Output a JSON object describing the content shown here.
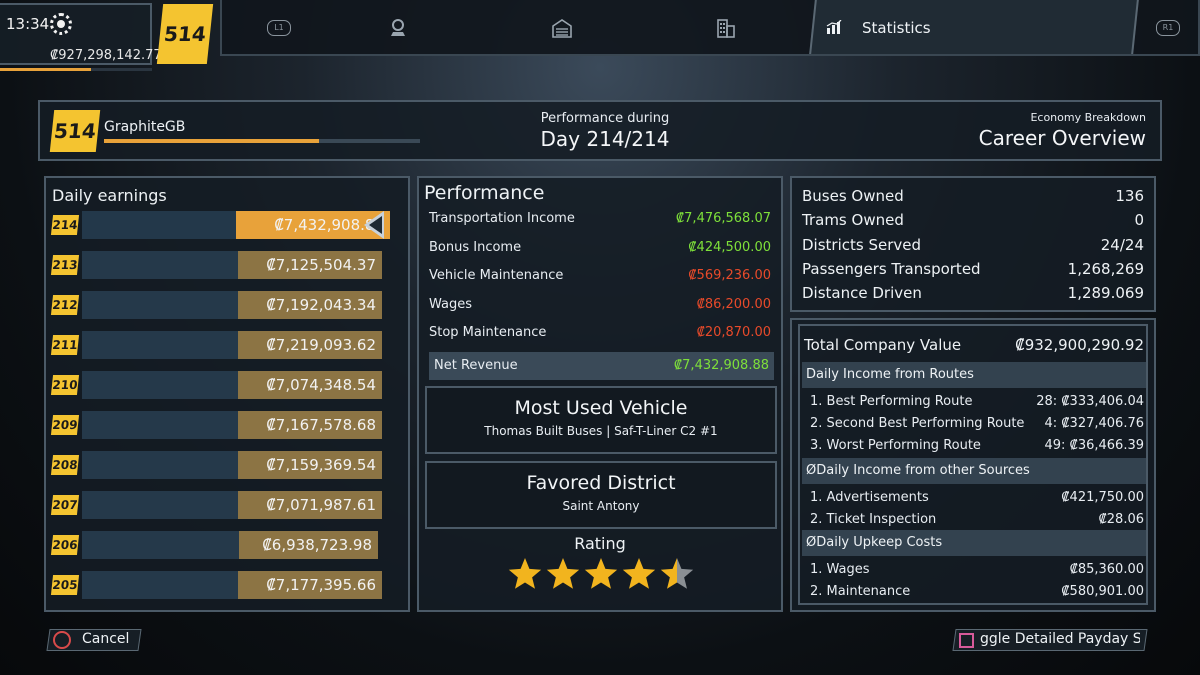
{
  "hud": {
    "time": "13:34",
    "money": "₡927,298,142.77",
    "level": "514",
    "xp_progress": 0.6
  },
  "nav": {
    "left_button": "L1",
    "right_button": "R1",
    "icons": [
      "map-pin-icon",
      "depot-icon",
      "city-buildings-icon",
      "chart-icon"
    ],
    "active_label": "Statistics"
  },
  "header": {
    "level": "514",
    "player_name": "GraphiteGB",
    "xp_progress": 0.68,
    "perf_line1": "Performance during",
    "perf_line2": "Day 214/214",
    "right_line1": "Economy Breakdown",
    "right_line2": "Career Overview"
  },
  "earnings": {
    "title": "Daily earnings",
    "rows": [
      {
        "day": "214",
        "value": "₡7,432,908.88",
        "fraction": 0.5
      },
      {
        "day": "213",
        "value": "₡7,125,504.37",
        "fraction": 0.48
      },
      {
        "day": "212",
        "value": "₡7,192,043.34",
        "fraction": 0.48
      },
      {
        "day": "211",
        "value": "₡7,219,093.62",
        "fraction": 0.48
      },
      {
        "day": "210",
        "value": "₡7,074,348.54",
        "fraction": 0.48
      },
      {
        "day": "209",
        "value": "₡7,167,578.68",
        "fraction": 0.48
      },
      {
        "day": "208",
        "value": "₡7,159,369.54",
        "fraction": 0.48
      },
      {
        "day": "207",
        "value": "₡7,071,987.61",
        "fraction": 0.48
      },
      {
        "day": "206",
        "value": "₡6,938,723.98",
        "fraction": 0.47
      },
      {
        "day": "205",
        "value": "₡7,177,395.66",
        "fraction": 0.48
      }
    ]
  },
  "performance": {
    "title": "Performance",
    "rows": [
      {
        "label": "Transportation Income",
        "value": "₡7,476,568.07",
        "sign": "pos"
      },
      {
        "label": "Bonus Income",
        "value": "₡424,500.00",
        "sign": "pos"
      },
      {
        "label": "Vehicle Maintenance",
        "value": "₡569,236.00",
        "sign": "neg"
      },
      {
        "label": "Wages",
        "value": "₡86,200.00",
        "sign": "neg"
      },
      {
        "label": "Stop Maintenance",
        "value": "₡20,870.00",
        "sign": "neg"
      }
    ],
    "net_label": "Net Revenue",
    "net_value": "₡7,432,908.88",
    "most_used_title": "Most Used Vehicle",
    "most_used_value": "Thomas Built Buses | Saf-T-Liner C2 #1",
    "favored_title": "Favored District",
    "favored_value": "Saint Antony",
    "rating_title": "Rating",
    "rating": 4.5,
    "rating_max": 5
  },
  "stats": {
    "rows": [
      {
        "label": "Buses Owned",
        "value": "136"
      },
      {
        "label": "Trams Owned",
        "value": "0"
      },
      {
        "label": "Districts Served",
        "value": "24/24"
      },
      {
        "label": "Passengers Transported",
        "value": "1,268,269"
      },
      {
        "label": "Distance Driven",
        "value": "1,289.069"
      }
    ],
    "company_value_label": "Total Company Value",
    "company_value": "₡932,900,290.92",
    "sections": [
      {
        "title": "Daily Income from Routes",
        "items": [
          {
            "label": "1. Best Performing Route",
            "value": "28: ₡333,406.04"
          },
          {
            "label": "2. Second Best Performing Route",
            "value": "4: ₡327,406.76"
          },
          {
            "label": "3. Worst Performing Route",
            "value": "49: ₡36,466.39"
          }
        ]
      },
      {
        "title": "ØDaily Income from other Sources",
        "items": [
          {
            "label": "1. Advertisements",
            "value": "₡421,750.00"
          },
          {
            "label": "2. Ticket Inspection",
            "value": "₡28.06"
          }
        ]
      },
      {
        "title": "ØDaily Upkeep Costs",
        "items": [
          {
            "label": "1. Wages",
            "value": "₡85,360.00"
          },
          {
            "label": "2. Maintenance",
            "value": "₡580,901.00"
          }
        ]
      }
    ]
  },
  "buttons": {
    "cancel": "Cancel",
    "toggle": "ggle Detailed Payday Sta"
  },
  "colors": {
    "accent": "#f4c430",
    "bar_selected": "#e8a23a",
    "bar": "#8c7444",
    "positive": "#7ee03a",
    "negative": "#e84a2a"
  }
}
